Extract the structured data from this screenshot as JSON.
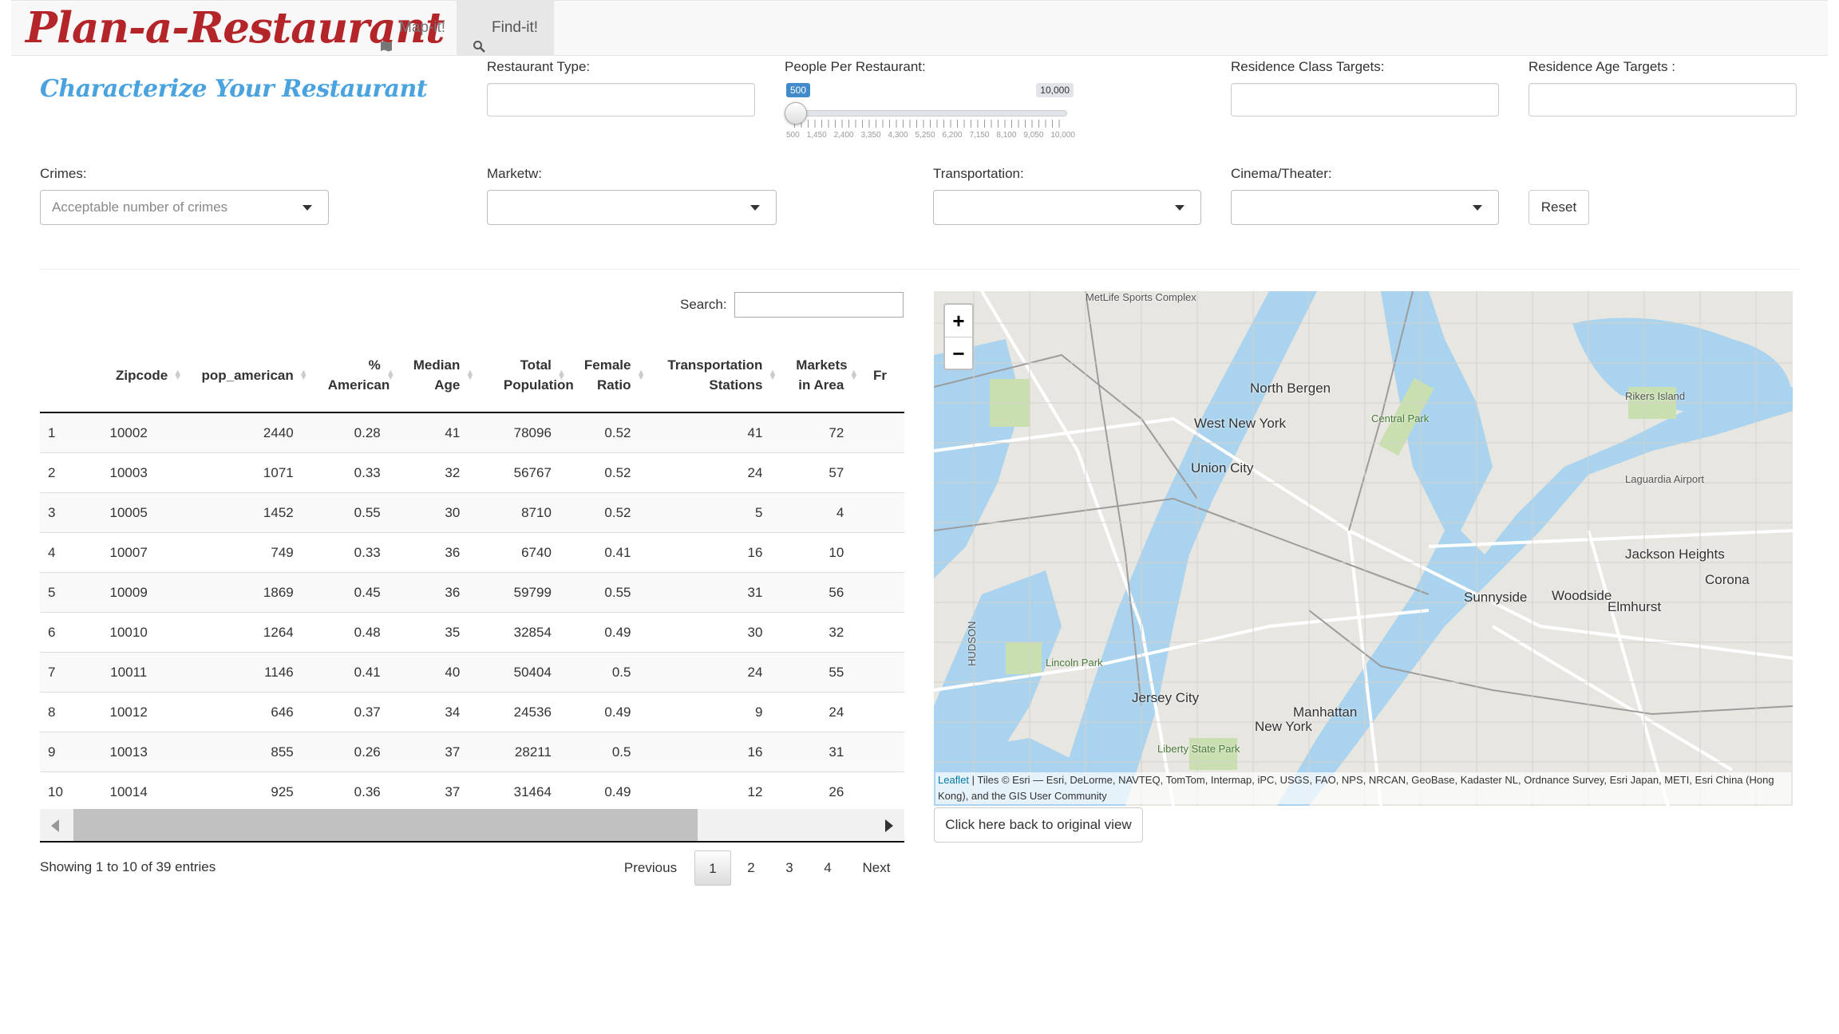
{
  "app": {
    "brand": "Plan-a-Restaurant"
  },
  "nav": {
    "tabs": [
      {
        "label": "Map-it!",
        "icon": "map-icon"
      },
      {
        "label": "Find-it!",
        "icon": "search-icon",
        "active": true
      }
    ]
  },
  "filters": {
    "section_title": "Characterize Your Restaurant",
    "restaurant_type": {
      "label": "Restaurant Type:",
      "value": ""
    },
    "people_per_restaurant": {
      "label": "People Per Restaurant:",
      "min_label": "500",
      "max_label": "10,000",
      "value": 500,
      "min": 500,
      "max": 10000,
      "grid": [
        "500",
        "1,450",
        "2,400",
        "3,350",
        "4,300",
        "5,250",
        "6,200",
        "7,150",
        "8,100",
        "9,050",
        "10,000"
      ]
    },
    "residence_class": {
      "label": "Residence Class Targets:",
      "value": ""
    },
    "residence_age": {
      "label": "Residence Age Targets :",
      "value": ""
    },
    "crimes": {
      "label": "Crimes:",
      "placeholder": "Acceptable number of crimes"
    },
    "market": {
      "label": "Marketw:",
      "value": ""
    },
    "transportation": {
      "label": "Transportation:",
      "value": ""
    },
    "cinema": {
      "label": "Cinema/Theater:",
      "value": ""
    },
    "reset_label": "Reset"
  },
  "table": {
    "search_label": "Search:",
    "columns": [
      " ",
      "Zipcode",
      "pop_american",
      "% American",
      "Median Age",
      "Total Population",
      "Female Ratio",
      "Transportation Stations",
      "Markets in Area",
      "Fr"
    ],
    "rows": [
      [
        "1",
        "10002",
        "2440",
        "0.28",
        "41",
        "78096",
        "0.52",
        "41",
        "72"
      ],
      [
        "2",
        "10003",
        "1071",
        "0.33",
        "32",
        "56767",
        "0.52",
        "24",
        "57"
      ],
      [
        "3",
        "10005",
        "1452",
        "0.55",
        "30",
        "8710",
        "0.52",
        "5",
        "4"
      ],
      [
        "4",
        "10007",
        "749",
        "0.33",
        "36",
        "6740",
        "0.41",
        "16",
        "10"
      ],
      [
        "5",
        "10009",
        "1869",
        "0.45",
        "36",
        "59799",
        "0.55",
        "31",
        "56"
      ],
      [
        "6",
        "10010",
        "1264",
        "0.48",
        "35",
        "32854",
        "0.49",
        "30",
        "32"
      ],
      [
        "7",
        "10011",
        "1146",
        "0.41",
        "40",
        "50404",
        "0.5",
        "24",
        "55"
      ],
      [
        "8",
        "10012",
        "646",
        "0.37",
        "34",
        "24536",
        "0.49",
        "9",
        "24"
      ],
      [
        "9",
        "10013",
        "855",
        "0.26",
        "37",
        "28211",
        "0.5",
        "16",
        "31"
      ],
      [
        "10",
        "10014",
        "925",
        "0.36",
        "37",
        "31464",
        "0.49",
        "12",
        "26"
      ]
    ],
    "info": "Showing 1 to 10 of 39 entries",
    "pagination": {
      "previous": "Previous",
      "pages": [
        "1",
        "2",
        "3",
        "4"
      ],
      "current": "1",
      "next": "Next"
    }
  },
  "map": {
    "zoom_in": "+",
    "zoom_out": "−",
    "attribution_link": "Leaflet",
    "attribution": " | Tiles © Esri — Esri, DeLorme, NAVTEQ, TomTom, Intermap, iPC, USGS, FAO, NPS, NRCAN, GeoBase, Kadaster NL, Ordnance Survey, Esri Japan, METI, Esri China (Hong Kong), and the GIS User Community",
    "reset_view_label": "Click here back to original view",
    "labels": {
      "north_bergen": "North Bergen",
      "west_new_york": "West New York",
      "union_city": "Union City",
      "jersey_city": "Jersey City",
      "manhattan": "Manhattan",
      "new_york": "New York",
      "jackson_heights": "Jackson Heights",
      "corona": "Corona",
      "sunnyside": "Sunnyside",
      "woodside": "Woodside",
      "elmhurst": "Elmhurst",
      "rikers": "Rikers Island",
      "laguardia": "Laguardia Airport",
      "central_park": "Central Park",
      "liberty": "Liberty State Park",
      "lincoln": "Lincoln Park",
      "metlife": "MetLife Sports Complex",
      "hudson": "HUDSON"
    },
    "colors": {
      "water": "#a9d3ee",
      "land": "#e8e6e1",
      "park": "#c9dfb0",
      "road": "#ffffff"
    }
  }
}
